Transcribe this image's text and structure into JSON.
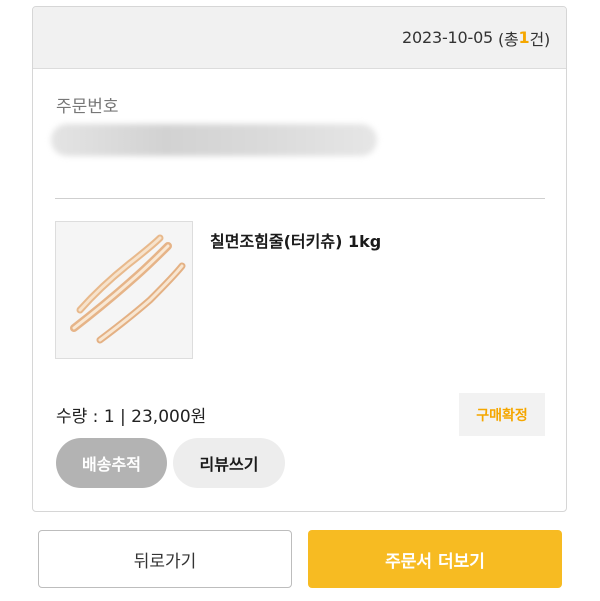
{
  "order": {
    "date": "2023-10-05",
    "count_prefix": "(총 ",
    "count": "1",
    "count_suffix": "건)",
    "order_number_label": "주문번호",
    "order_number_value": ""
  },
  "product": {
    "name": "칠면조힘줄(터키츄) 1kg",
    "quantity_price": "수량 : 1 | 23,000원",
    "confirm_label": "구매확정",
    "image_icon": "dried-turkey-tendon-photo"
  },
  "actions": {
    "track_label": "배송추적",
    "review_label": "리뷰쓰기"
  },
  "footer": {
    "back_label": "뒤로가기",
    "more_label": "주문서 더보기"
  },
  "colors": {
    "accent": "#f5a700",
    "primary_button": "#f7bb22",
    "pill_gray": "#b3b3b3"
  }
}
